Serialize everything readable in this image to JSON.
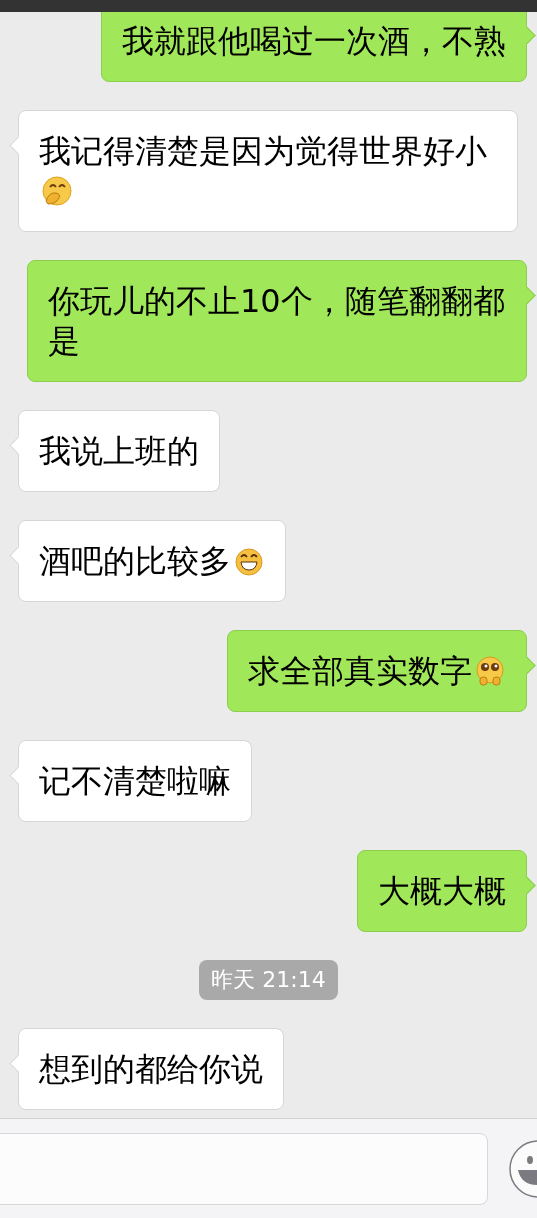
{
  "messages": [
    {
      "kind": "message",
      "sent": true,
      "text": "我就跟他喝过一次酒，不熟"
    },
    {
      "kind": "message",
      "sent": false,
      "text": "我记得清楚是因为觉得世界好小",
      "emoji": {
        "kind": "covermouth"
      }
    },
    {
      "kind": "message",
      "sent": true,
      "text": "你玩儿的不止10个，随笔翻翻都是"
    },
    {
      "kind": "message",
      "sent": false,
      "text": "我说上班的"
    },
    {
      "kind": "message",
      "sent": false,
      "text": "酒吧的比较多",
      "emoji": {
        "kind": "grin"
      }
    },
    {
      "kind": "message",
      "sent": true,
      "text": "求全部真实数字",
      "emoji": {
        "kind": "pleading"
      }
    },
    {
      "kind": "message",
      "sent": false,
      "text": "记不清楚啦嘛"
    },
    {
      "kind": "message",
      "sent": true,
      "text": "大概大概"
    },
    {
      "kind": "time",
      "text": "昨天 21:14"
    },
    {
      "kind": "message",
      "sent": false,
      "text": "想到的都给你说"
    }
  ]
}
